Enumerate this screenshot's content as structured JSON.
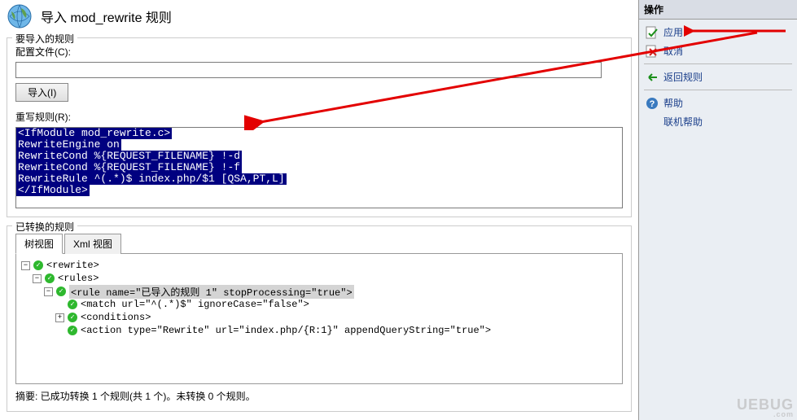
{
  "header": {
    "title": "导入 mod_rewrite 规则"
  },
  "fieldset_import": {
    "legend": "要导入的规则",
    "config_file_label": "配置文件(C):",
    "config_file_value": "",
    "import_button": "导入(I)",
    "rewrite_label": "重写规则(R):",
    "code_lines": [
      "<IfModule mod_rewrite.c>",
      "RewriteEngine on",
      "RewriteCond %{REQUEST_FILENAME} !-d",
      "RewriteCond %{REQUEST_FILENAME} !-f",
      "RewriteRule ^(.*)$ index.php/$1 [QSA,PT,L]",
      "</IfModule>"
    ]
  },
  "fieldset_converted": {
    "legend": "已转换的规则",
    "tabs": {
      "tree": "树视图",
      "xml": "Xml 视图"
    },
    "tree": {
      "n0": "<rewrite>",
      "n1": "<rules>",
      "n2": "<rule name=\"已导入的规则 1\" stopProcessing=\"true\">",
      "n3": "<match url=\"^(.*)$\" ignoreCase=\"false\">",
      "n4": "<conditions>",
      "n5": "<action type=\"Rewrite\" url=\"index.php/{R:1}\" appendQueryString=\"true\">"
    },
    "summary": "摘要: 已成功转换 1 个规则(共 1 个)。未转换 0 个规则。"
  },
  "sidebar": {
    "header": "操作",
    "apply": "应用",
    "cancel": "取消",
    "back": "返回规则",
    "help": "帮助",
    "online_help": "联机帮助"
  }
}
